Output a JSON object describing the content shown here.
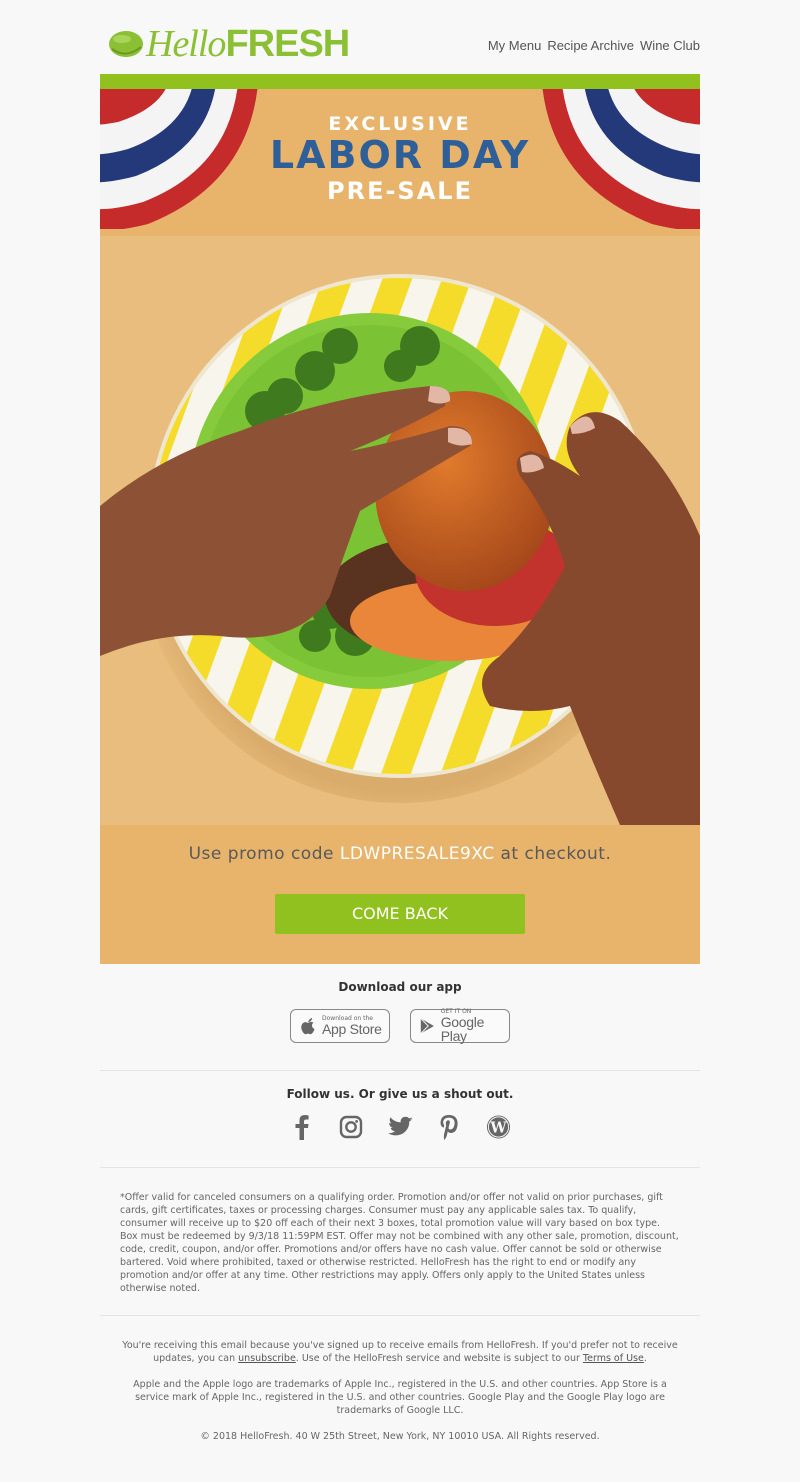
{
  "header": {
    "logo_text_hello": "Hello",
    "logo_text_fresh": "FRESH",
    "nav": [
      {
        "label": "My Menu"
      },
      {
        "label": "Recipe Archive"
      },
      {
        "label": "Wine Club"
      }
    ]
  },
  "banner": {
    "line1": "EXCLUSIVE",
    "line2": "LABOR DAY",
    "line3": "PRE-SALE"
  },
  "hero": {
    "image_description": "Hands holding a burger on a green plate with broccoli atop a yellow-and-white striped plate"
  },
  "promo": {
    "prefix": "Use promo code ",
    "code": "LDWPRESALE9XC",
    "suffix": " at checkout.",
    "cta_label": "COME BACK"
  },
  "app": {
    "title": "Download our app",
    "app_store": {
      "small": "Download on the",
      "big": "App Store"
    },
    "google_play": {
      "small": "GET IT ON",
      "big": "Google Play"
    }
  },
  "social": {
    "title": "Follow us. Or give us a shout out.",
    "icons": [
      "facebook-icon",
      "instagram-icon",
      "twitter-icon",
      "pinterest-icon",
      "wordpress-icon"
    ]
  },
  "fine_print": "*Offer valid for canceled consumers on a qualifying order. Promotion and/or offer not valid on prior purchases, gift cards, gift certificates, taxes or processing charges. Consumer must pay any applicable sales tax. To qualify, consumer will receive up to $20 off each of their next 3 boxes, total promotion value will vary based on box type. Box must be redeemed by 9/3/18 11:59PM EST. Offer may not be combined with any other sale, promotion, discount, code, credit, coupon, and/or offer. Promotions and/or offers have no cash value. Offer cannot be sold or otherwise bartered. Void where prohibited, taxed or otherwise restricted. HelloFresh has the right to end or modify any promotion and/or offer at any time. Other restrictions may apply. Offers only apply to the United States unless otherwise noted.",
  "footer": {
    "receiving_prefix": "You're receiving this email because you've signed up to receive emails from HelloFresh. If you'd prefer not to receive updates, you can ",
    "unsubscribe_label": "unsubscribe",
    "receiving_middle": ". Use of the HelloFresh service and website is subject to our ",
    "terms_label": "Terms of Use",
    "receiving_suffix": ".",
    "trademarks": "Apple and the Apple logo are trademarks of Apple Inc., registered in the U.S. and other countries. App Store is a service mark of Apple Inc., registered in the U.S. and other countries. Google Play and the Google Play logo are trademarks of Google LLC.",
    "copyright": "© 2018 HelloFresh. 40 W 25th Street, New York, NY 10010 USA. All Rights reserved."
  },
  "colors": {
    "brand_green": "#91c11e",
    "banner_orange": "#e8b46c",
    "labor_day_blue": "#2f5f99"
  }
}
